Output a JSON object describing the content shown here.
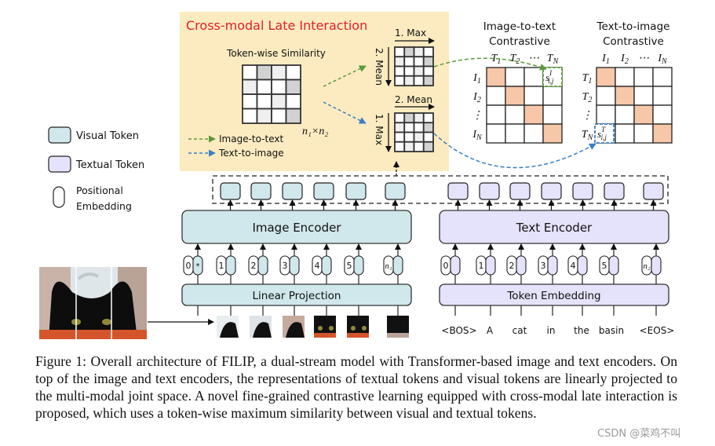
{
  "figure": {
    "late_interaction": {
      "title": "Cross-modal Late Interaction",
      "similarity_label": "Token-wise Similarity",
      "size_label": "n₁×n₂",
      "legend_i2t": "Image-to-text",
      "legend_t2i": "Text-to-image",
      "top_step1": "1. Max",
      "top_step2": "2. Mean",
      "bottom_step1": "1. Max",
      "bottom_step2": "2. Mean",
      "shading": [
        [
          0,
          2,
          1,
          0
        ],
        [
          1,
          0,
          0,
          2
        ],
        [
          0,
          0,
          1,
          0
        ],
        [
          0,
          1,
          0,
          2
        ]
      ]
    },
    "i2t": {
      "title1": "Image-to-text",
      "title2": "Contrastive",
      "cols": [
        {
          "b": "T",
          "s": "1"
        },
        {
          "b": "T",
          "s": "2"
        },
        {
          "b": "⋯",
          "s": ""
        },
        {
          "b": "T",
          "s": "N"
        }
      ],
      "rows": [
        {
          "b": "I",
          "s": "1"
        },
        {
          "b": "I",
          "s": "2"
        },
        {
          "b": "⋮",
          "s": ""
        },
        {
          "b": "I",
          "s": "N"
        }
      ],
      "score": {
        "b": "s",
        "s": "i,j",
        "sup": "I"
      }
    },
    "t2i": {
      "title1": "Text-to-image",
      "title2": "Contrastive",
      "cols": [
        {
          "b": "I",
          "s": "1"
        },
        {
          "b": "I",
          "s": "2"
        },
        {
          "b": "⋯",
          "s": ""
        },
        {
          "b": "I",
          "s": "N"
        }
      ],
      "rows": [
        {
          "b": "T",
          "s": "1"
        },
        {
          "b": "T",
          "s": "2"
        },
        {
          "b": "⋮",
          "s": ""
        },
        {
          "b": "T",
          "s": "N"
        }
      ],
      "score": {
        "b": "s",
        "s": "i,j",
        "sup": "T"
      }
    },
    "legend": {
      "visual_token": "Visual Token",
      "textual_token": "Textual Token",
      "positional_1": "Positional",
      "positional_2": "Embedding"
    },
    "image_encoder": "Image Encoder",
    "text_encoder": "Text Encoder",
    "linear_projection": "Linear Projection",
    "token_embedding": "Token Embedding",
    "image_positions": [
      "0",
      "1",
      "2",
      "3",
      "4",
      "5",
      "n₁"
    ],
    "image_cls_mark": "*",
    "text_positions": [
      "0",
      "1",
      "2",
      "3",
      "4",
      "5",
      "n₂"
    ],
    "ellipsis": "⋯",
    "words": [
      "<BOS>",
      "A",
      "cat",
      "in",
      "the",
      "basin",
      "<EOS>"
    ],
    "colors": {
      "panel": "#fcebc0",
      "title_red": "#e0202a",
      "visual": "#d0e7eb",
      "textual": "#e5e2fb",
      "diag": "#f6c7a8",
      "green": "#5a9a3a",
      "blue": "#3a7fc4"
    }
  },
  "caption": {
    "text": "Figure 1:  Overall architecture of FILIP, a dual-stream model with Transformer-based image and text encoders.  On top of the image and text encoders, the representations of textual tokens and visual tokens are linearly projected to the multi-modal joint space. A novel fine-grained contrastive learning equipped with cross-modal late interaction is proposed, which uses a token-wise maximum similarity between visual and textual tokens."
  },
  "watermark": "CSDN @菜鸡不叫"
}
